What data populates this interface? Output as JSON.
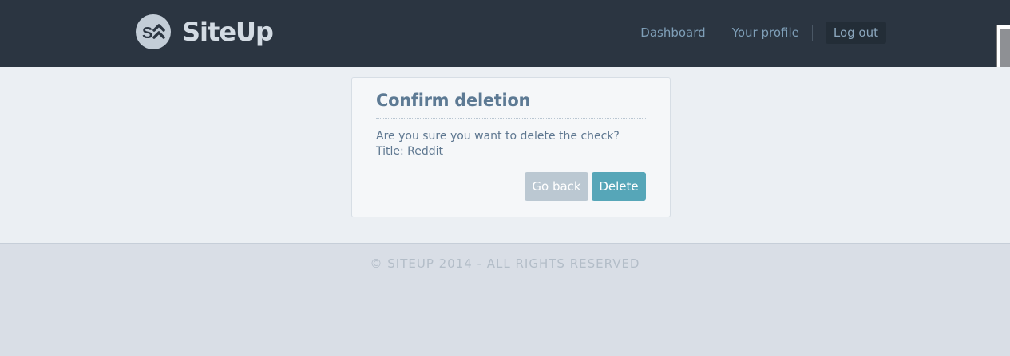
{
  "header": {
    "brand": "SiteUp",
    "nav": [
      {
        "label": "Dashboard"
      },
      {
        "label": "Your profile"
      }
    ],
    "logout_label": "Log out"
  },
  "dialog": {
    "title": "Confirm deletion",
    "message": "Are you sure you want to delete the check?",
    "detail": "Title: Reddit",
    "back_label": "Go back",
    "delete_label": "Delete"
  },
  "footer": {
    "copyright": "© SITEUP 2014 - ALL RIGHTS RESERVED"
  },
  "colors": {
    "header_bg": "#2b3541",
    "accent": "#56a6b8",
    "secondary_button": "#bbc8d2"
  }
}
